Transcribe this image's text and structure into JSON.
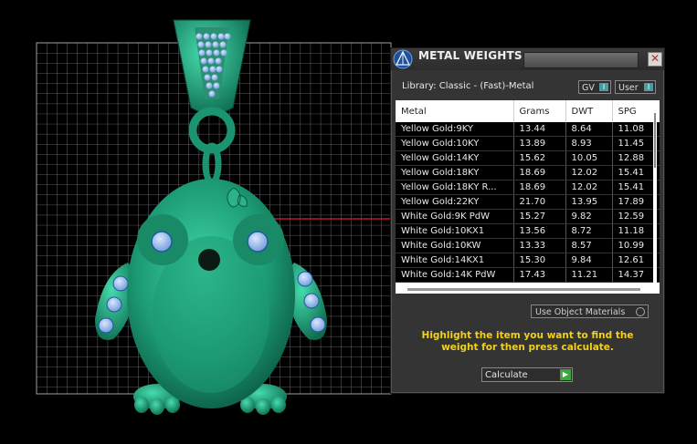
{
  "panel": {
    "title": "METAL WEIGHTS",
    "close_glyph": "✕",
    "library_label": "Library: Classic - (Fast)-Metal",
    "gv_label": "GV",
    "user_label": "User",
    "toggle_glyph": "I",
    "use_object_materials": "Use Object Materials",
    "instruction": "Highlight the item you want to find the weight for then press calculate.",
    "calculate_label": "Calculate",
    "calculate_glyph": "▶"
  },
  "table": {
    "columns": [
      "Metal",
      "Grams",
      "DWT",
      "SPG"
    ],
    "rows": [
      [
        "Yellow Gold:9KY",
        "13.44",
        "8.64",
        "11.08"
      ],
      [
        "Yellow Gold:10KY",
        "13.89",
        "8.93",
        "11.45"
      ],
      [
        "Yellow Gold:14KY",
        "15.62",
        "10.05",
        "12.88"
      ],
      [
        "Yellow Gold:18KY",
        "18.69",
        "12.02",
        "15.41"
      ],
      [
        "Yellow Gold:18KY R...",
        "18.69",
        "12.02",
        "15.41"
      ],
      [
        "Yellow Gold:22KY",
        "21.70",
        "13.95",
        "17.89"
      ],
      [
        "White Gold:9K PdW",
        "15.27",
        "9.82",
        "12.59"
      ],
      [
        "White Gold:10KX1",
        "13.56",
        "8.72",
        "11.18"
      ],
      [
        "White Gold:10KW",
        "13.33",
        "8.57",
        "10.99"
      ],
      [
        "White Gold:14KX1",
        "15.30",
        "9.84",
        "12.61"
      ],
      [
        "White Gold:14K PdW",
        "17.43",
        "11.21",
        "14.37"
      ]
    ]
  },
  "colors": {
    "model_green": "#1fa07a",
    "gem_blue": "#a9c8f5",
    "instruction_yellow": "#f2d11a",
    "axis_red": "#c0142a",
    "grid": "#8a8a8a"
  },
  "icons": {
    "panel_logo": "pyramid-logo-icon",
    "close": "close-icon",
    "calculate": "play-icon"
  }
}
